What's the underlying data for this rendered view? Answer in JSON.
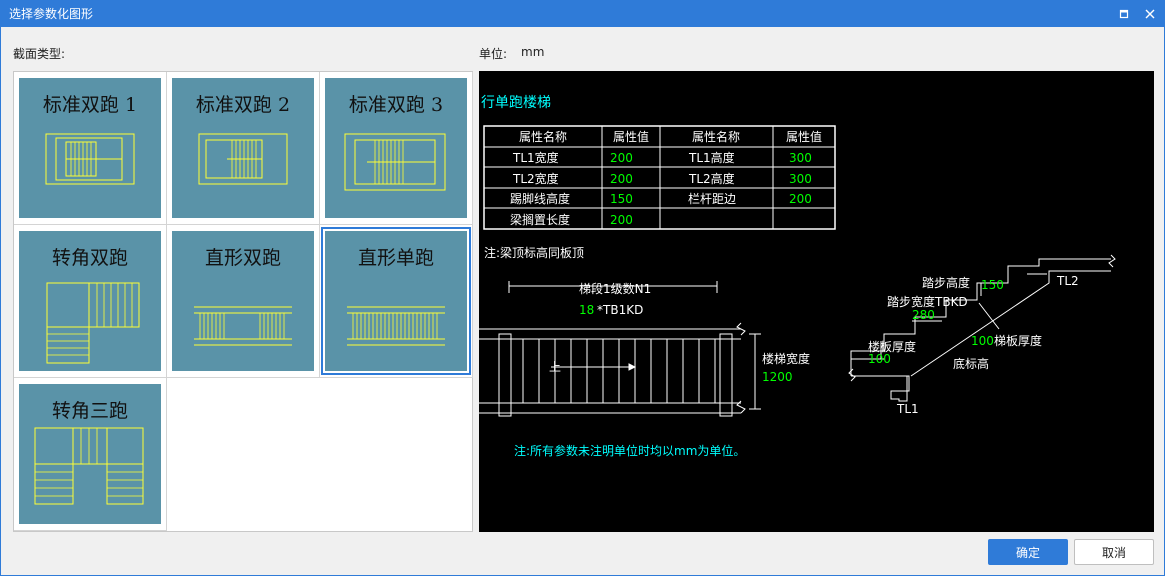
{
  "window": {
    "title": "选择参数化图形"
  },
  "labels": {
    "section_type": "截面类型:",
    "unit_label": "单位:",
    "unit_value": "mm"
  },
  "tiles": [
    {
      "name": "标准双跑 1"
    },
    {
      "name": "标准双跑 2"
    },
    {
      "name": "标准双跑 3"
    },
    {
      "name": "转角双跑"
    },
    {
      "name": "直形双跑"
    },
    {
      "name": "直形单跑"
    },
    {
      "name": "转角三跑"
    }
  ],
  "selected_tile": "直形单跑",
  "preview": {
    "title": "行单跑楼梯",
    "table_headers": [
      "属性名称",
      "属性值",
      "属性名称",
      "属性值"
    ],
    "table_rows": [
      [
        "TL1宽度",
        "200",
        "TL1高度",
        "300"
      ],
      [
        "TL2宽度",
        "200",
        "TL2高度",
        "300"
      ],
      [
        "踢脚线高度",
        "150",
        "栏杆距边",
        "200"
      ],
      [
        "梁搁置长度",
        "200",
        "",
        ""
      ]
    ],
    "note_top": "注:梁顶标高同板顶",
    "plan": {
      "segment_label": "梯段1级数N1",
      "steps_value": "18",
      "tread_formula": "*TB1KD",
      "up_label": "上",
      "width_label": "楼梯宽度",
      "width_value": "1200"
    },
    "section": {
      "riser_label": "踏步高度",
      "riser_value": "150",
      "tread_label": "踏步宽度TBKD",
      "tread_value": "280",
      "slab_label_left": "楼板厚度",
      "slab_value_left": "100",
      "slab_label_right": "梯板厚度",
      "slab_value_right": "100",
      "bottom_label": "底标高",
      "tl1": "TL1",
      "tl2": "TL2"
    },
    "note_bottom": "注:所有参数未注明单位时均以mm为单位。"
  },
  "buttons": {
    "ok": "确定",
    "cancel": "取消"
  },
  "colors": {
    "accent": "#2f7bd8",
    "tile_bg": "#5a93a8",
    "cad_yellow": "#ffff00",
    "cad_green": "#00ff00",
    "cad_cyan": "#00ffff"
  }
}
